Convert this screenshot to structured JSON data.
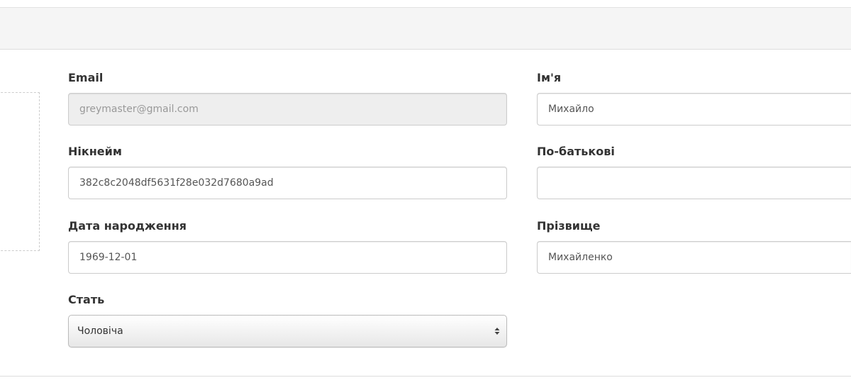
{
  "form": {
    "email": {
      "label": "Email",
      "value": "greymaster@gmail.com",
      "disabled": true
    },
    "nickname": {
      "label": "Нікнейм",
      "value": "382c8c2048df5631f28e032d7680a9ad"
    },
    "birth_date": {
      "label": "Дата народження",
      "value": "1969-12-01"
    },
    "gender": {
      "label": "Стать",
      "selected": "Чоловіча"
    },
    "first_name": {
      "label": "Ім'я",
      "value": "Михайло"
    },
    "patronymic": {
      "label": "По-батькові",
      "value": ""
    },
    "last_name": {
      "label": "Прізвище",
      "value": "Михайленко"
    }
  }
}
